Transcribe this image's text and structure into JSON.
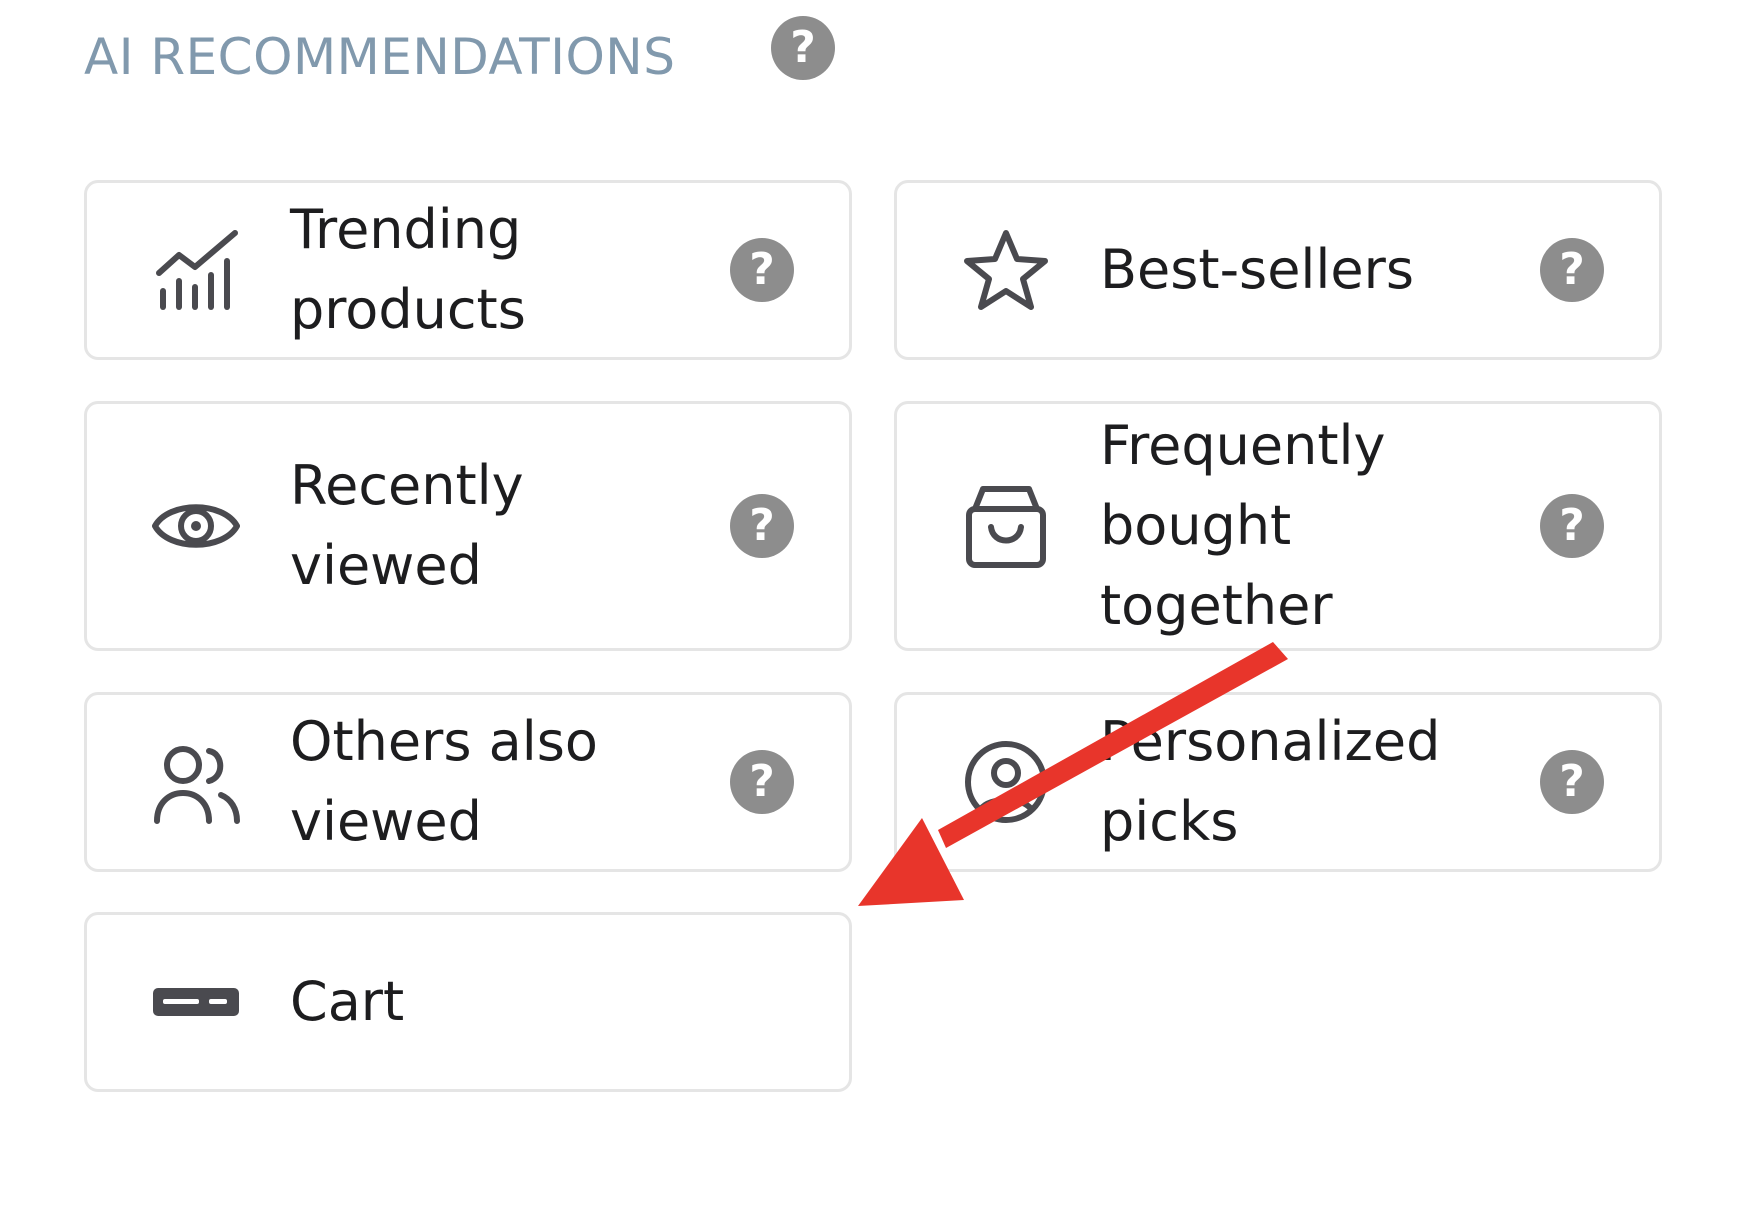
{
  "section": {
    "title": "AI RECOMMENDATIONS",
    "help_glyph": "?"
  },
  "cards": [
    {
      "label": "Trending products",
      "icon": "trending-chart-icon"
    },
    {
      "label": "Best-sellers",
      "icon": "star-icon"
    },
    {
      "label": "Recently viewed",
      "icon": "eye-icon"
    },
    {
      "label": "Frequently bought together",
      "icon": "shopping-bag-icon"
    },
    {
      "label": "Others also viewed",
      "icon": "users-icon"
    },
    {
      "label": "Personalized picks",
      "icon": "user-circle-icon"
    },
    {
      "label": "Cart",
      "icon": "cart-bar-icon"
    }
  ],
  "colors": {
    "title": "#8199ad",
    "text": "#1d1d1f",
    "icon": "#4a4a4f",
    "help_bg": "#8d8d8d",
    "card_border": "#e5e5e5",
    "annotation_arrow": "#e8352b"
  }
}
